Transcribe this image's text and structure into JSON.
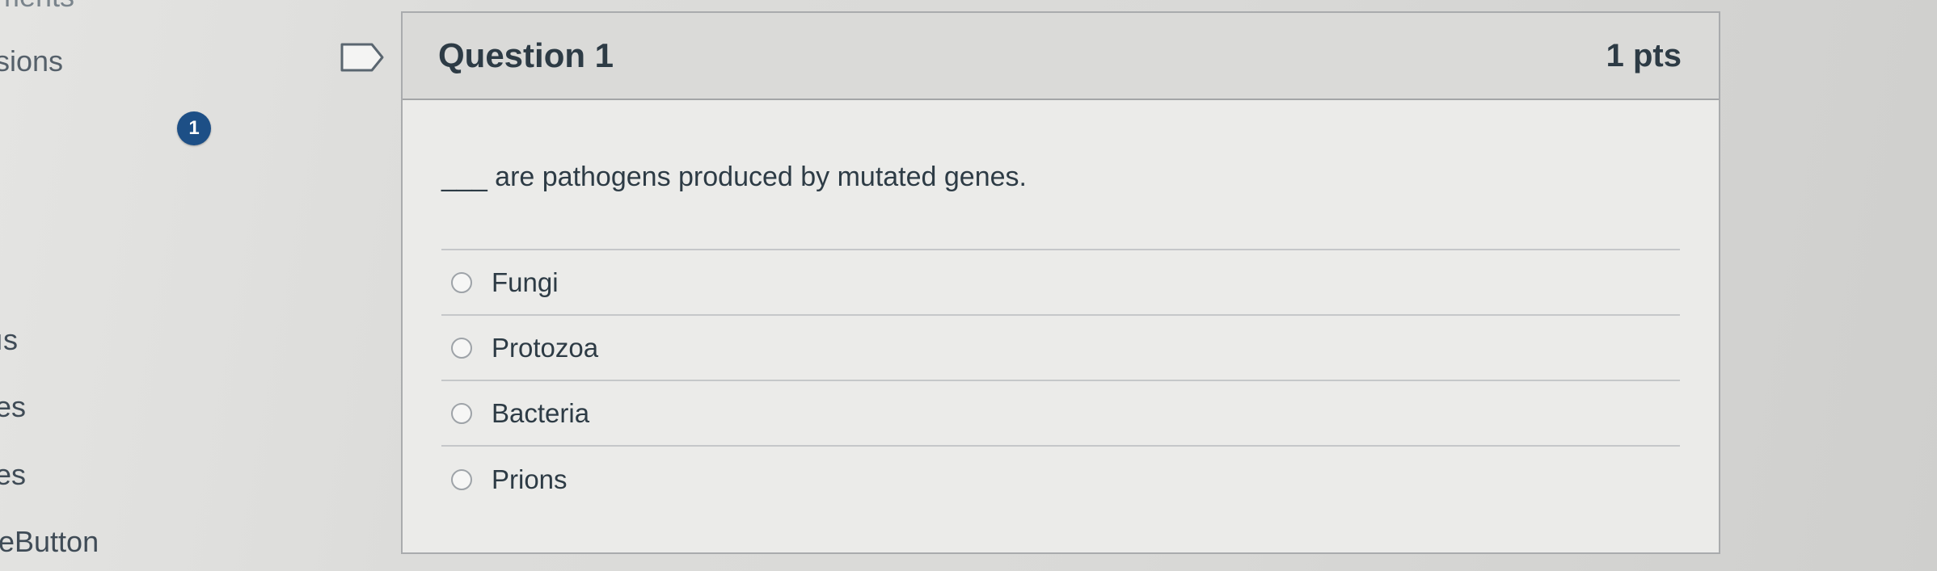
{
  "left_nav": {
    "items": [
      {
        "label": "ments"
      },
      {
        "label": "sions"
      },
      {
        "label": "ıs"
      },
      {
        "label": "es"
      },
      {
        "label": "es"
      },
      {
        "label": "eButton"
      }
    ]
  },
  "question_nav": {
    "badge_number": "1"
  },
  "question": {
    "title": "Question 1",
    "points": "1 pts",
    "text": "___ are pathogens produced by mutated genes.",
    "answers": [
      {
        "label": "Fungi",
        "selected": false
      },
      {
        "label": "Protozoa",
        "selected": false
      },
      {
        "label": "Bacteria",
        "selected": false
      },
      {
        "label": "Prions",
        "selected": false
      }
    ]
  },
  "colors": {
    "badge": "#1d4f86",
    "text": "#2d3b45",
    "card_background": "#ebebe9",
    "header_background": "#dadad8"
  }
}
